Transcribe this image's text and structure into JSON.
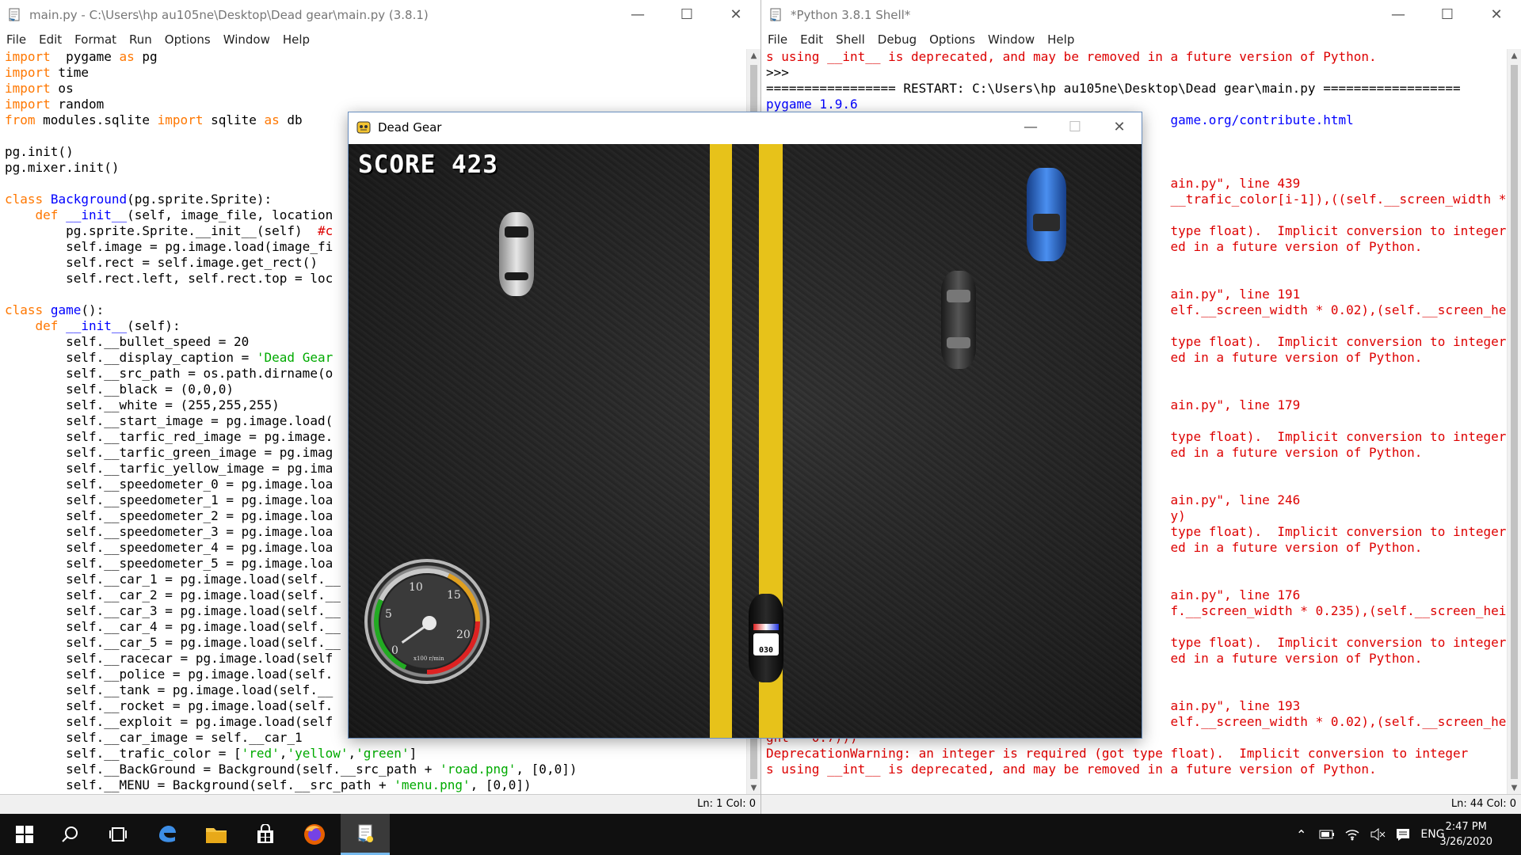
{
  "editor": {
    "title": "main.py - C:\\Users\\hp au105ne\\Desktop\\Dead gear\\main.py (3.8.1)",
    "menu": [
      "File",
      "Edit",
      "Format",
      "Run",
      "Options",
      "Window",
      "Help"
    ],
    "status": "Ln: 1   Col: 0",
    "lines": [
      [
        [
          "kw",
          "import"
        ],
        [
          "",
          "  pygame "
        ],
        [
          "kw",
          "as"
        ],
        [
          "",
          " pg"
        ]
      ],
      [
        [
          "kw",
          "import"
        ],
        [
          "",
          " time"
        ]
      ],
      [
        [
          "kw",
          "import"
        ],
        [
          "",
          " os"
        ]
      ],
      [
        [
          "kw",
          "import"
        ],
        [
          "",
          " random"
        ]
      ],
      [
        [
          "kw",
          "from"
        ],
        [
          "",
          " modules.sqlite "
        ],
        [
          "kw",
          "import"
        ],
        [
          "",
          " sqlite "
        ],
        [
          "kw",
          "as"
        ],
        [
          "",
          " db"
        ]
      ],
      [],
      [
        [
          "",
          "pg.init()"
        ]
      ],
      [
        [
          "",
          "pg.mixer.init()"
        ]
      ],
      [],
      [
        [
          "kw",
          "class"
        ],
        [
          "",
          " "
        ],
        [
          "df",
          "Background"
        ],
        [
          "",
          "(pg.sprite.Sprite):"
        ]
      ],
      [
        [
          "",
          "    "
        ],
        [
          "kw",
          "def"
        ],
        [
          "",
          " "
        ],
        [
          "df",
          "__init__"
        ],
        [
          "",
          "(self, image_file, location"
        ]
      ],
      [
        [
          "",
          "        pg.sprite.Sprite.__init__(self)  "
        ],
        [
          "cm",
          "#c"
        ]
      ],
      [
        [
          "",
          "        self.image = pg.image.load(image_fi"
        ]
      ],
      [
        [
          "",
          "        self.rect = self.image.get_rect()"
        ]
      ],
      [
        [
          "",
          "        self.rect.left, self.rect.top = loc"
        ]
      ],
      [],
      [
        [
          "kw",
          "class"
        ],
        [
          "",
          " "
        ],
        [
          "df",
          "game"
        ],
        [
          "",
          "():"
        ]
      ],
      [
        [
          "",
          "    "
        ],
        [
          "kw",
          "def"
        ],
        [
          "",
          " "
        ],
        [
          "df",
          "__init__"
        ],
        [
          "",
          "(self):"
        ]
      ],
      [
        [
          "",
          "        self.__bullet_speed = 20"
        ]
      ],
      [
        [
          "",
          "        self.__display_caption = "
        ],
        [
          "st",
          "'Dead Gear"
        ]
      ],
      [
        [
          "",
          "        self.__src_path = os.path.dirname(o"
        ]
      ],
      [
        [
          "",
          "        self.__black = (0,0,0)"
        ]
      ],
      [
        [
          "",
          "        self.__white = (255,255,255)"
        ]
      ],
      [
        [
          "",
          "        self.__start_image = pg.image.load("
        ]
      ],
      [
        [
          "",
          "        self.__tarfic_red_image = pg.image."
        ]
      ],
      [
        [
          "",
          "        self.__tarfic_green_image = pg.imag"
        ]
      ],
      [
        [
          "",
          "        self.__tarfic_yellow_image = pg.ima"
        ]
      ],
      [
        [
          "",
          "        self.__speedometer_0 = pg.image.loa"
        ]
      ],
      [
        [
          "",
          "        self.__speedometer_1 = pg.image.loa"
        ]
      ],
      [
        [
          "",
          "        self.__speedometer_2 = pg.image.loa"
        ]
      ],
      [
        [
          "",
          "        self.__speedometer_3 = pg.image.loa"
        ]
      ],
      [
        [
          "",
          "        self.__speedometer_4 = pg.image.loa"
        ]
      ],
      [
        [
          "",
          "        self.__speedometer_5 = pg.image.loa"
        ]
      ],
      [
        [
          "",
          "        self.__car_1 = pg.image.load(self.__"
        ]
      ],
      [
        [
          "",
          "        self.__car_2 = pg.image.load(self.__"
        ]
      ],
      [
        [
          "",
          "        self.__car_3 = pg.image.load(self.__"
        ]
      ],
      [
        [
          "",
          "        self.__car_4 = pg.image.load(self.__"
        ]
      ],
      [
        [
          "",
          "        self.__car_5 = pg.image.load(self.__"
        ]
      ],
      [
        [
          "",
          "        self.__racecar = pg.image.load(self"
        ]
      ],
      [
        [
          "",
          "        self.__police = pg.image.load(self."
        ]
      ],
      [
        [
          "",
          "        self.__tank = pg.image.load(self.__"
        ]
      ],
      [
        [
          "",
          "        self.__rocket = pg.image.load(self."
        ]
      ],
      [
        [
          "",
          "        self.__exploit = pg.image.load(self"
        ]
      ],
      [
        [
          "",
          "        self.__car_image = self.__car_1"
        ]
      ],
      [
        [
          "",
          "        self.__trafic_color = ["
        ],
        [
          "st",
          "'red'"
        ],
        [
          "",
          ","
        ],
        [
          "st",
          "'yellow'"
        ],
        [
          "",
          ","
        ],
        [
          "st",
          "'green'"
        ],
        [
          "",
          "]"
        ]
      ],
      [
        [
          "",
          "        self.__BackGround = Background(self.__src_path + "
        ],
        [
          "st",
          "'road.png'"
        ],
        [
          "",
          ", [0,0])"
        ]
      ],
      [
        [
          "",
          "        self.__MENU = Background(self.__src_path + "
        ],
        [
          "st",
          "'menu.png'"
        ],
        [
          "",
          ", [0,0])"
        ]
      ]
    ]
  },
  "shell": {
    "title": "*Python 3.8.1 Shell*",
    "menu": [
      "File",
      "Edit",
      "Shell",
      "Debug",
      "Options",
      "Window",
      "Help"
    ],
    "status": "Ln: 44   Col: 0",
    "lines": [
      [
        [
          "err",
          "s using __int__ is deprecated, and may be removed in a future version of Python."
        ]
      ],
      [
        [
          "",
          ">>>"
        ]
      ],
      [
        [
          "",
          "================= RESTART: C:\\Users\\hp au105ne\\Desktop\\Dead gear\\main.py =================="
        ]
      ],
      [
        [
          "blue",
          "pygame 1.9.6"
        ]
      ],
      [
        [
          "blue",
          "                                                     game.org/contribute.html"
        ]
      ],
      [],
      [],
      [],
      [
        [
          "err",
          "                                                     ain.py\", line 439"
        ]
      ],
      [
        [
          "err",
          "                                                     __trafic_color[i-1]),((self.__screen_width *"
        ]
      ],
      [],
      [
        [
          "err",
          "                                                     type float).  Implicit conversion to integer"
        ]
      ],
      [
        [
          "err",
          "                                                     ed in a future version of Python."
        ]
      ],
      [],
      [],
      [
        [
          "err",
          "                                                     ain.py\", line 191"
        ]
      ],
      [
        [
          "err",
          "                                                     elf.__screen_width * 0.02),(self.__screen_hei"
        ]
      ],
      [],
      [
        [
          "err",
          "                                                     type float).  Implicit conversion to integer"
        ]
      ],
      [
        [
          "err",
          "                                                     ed in a future version of Python."
        ]
      ],
      [],
      [],
      [
        [
          "err",
          "                                                     ain.py\", line 179"
        ]
      ],
      [],
      [
        [
          "err",
          "                                                     type float).  Implicit conversion to integer"
        ]
      ],
      [
        [
          "err",
          "                                                     ed in a future version of Python."
        ]
      ],
      [],
      [],
      [
        [
          "err",
          "                                                     ain.py\", line 246"
        ]
      ],
      [
        [
          "err",
          "                                                     y)"
        ]
      ],
      [
        [
          "err",
          "                                                     type float).  Implicit conversion to integer"
        ]
      ],
      [
        [
          "err",
          "                                                     ed in a future version of Python."
        ]
      ],
      [],
      [],
      [
        [
          "err",
          "                                                     ain.py\", line 176"
        ]
      ],
      [
        [
          "err",
          "                                                     f.__screen_width * 0.235),(self.__screen_heig"
        ]
      ],
      [],
      [
        [
          "err",
          "                                                     type float).  Implicit conversion to integer"
        ]
      ],
      [
        [
          "err",
          "                                                     ed in a future version of Python."
        ]
      ],
      [],
      [],
      [
        [
          "err",
          "                                                     ain.py\", line 193"
        ]
      ],
      [
        [
          "err",
          "                                                     elf.__screen_width * 0.02),(self.__screen_hei"
        ]
      ],
      [
        [
          "err",
          "ght * 0.7)))"
        ]
      ],
      [
        [
          "err",
          "DeprecationWarning: an integer is required (got type float).  Implicit conversion to integer"
        ]
      ],
      [
        [
          "err",
          "s using __int__ is deprecated, and may be removed in a future version of Python."
        ]
      ]
    ]
  },
  "game": {
    "title": "Dead Gear",
    "score_label": "SCORE 423",
    "speedo_ticks": [
      "0",
      "5",
      "10",
      "15",
      "20"
    ],
    "speedo_unit": "x100 r/min",
    "police_number": "030",
    "cars": [
      {
        "name": "silver-car",
        "color": "#b8b8b8"
      },
      {
        "name": "blue-car",
        "color": "#2d6fd0"
      },
      {
        "name": "black-car",
        "color": "#3a3a3a"
      },
      {
        "name": "police-car",
        "color": "#111111"
      }
    ]
  },
  "taskbar": {
    "icons": [
      "windows-start-icon",
      "search-icon",
      "task-view-icon",
      "edge-icon",
      "file-explorer-icon",
      "store-icon",
      "firefox-icon",
      "python-idle-icon"
    ],
    "language": "ENG",
    "time": "2:47 PM",
    "date": "3/26/2020"
  }
}
